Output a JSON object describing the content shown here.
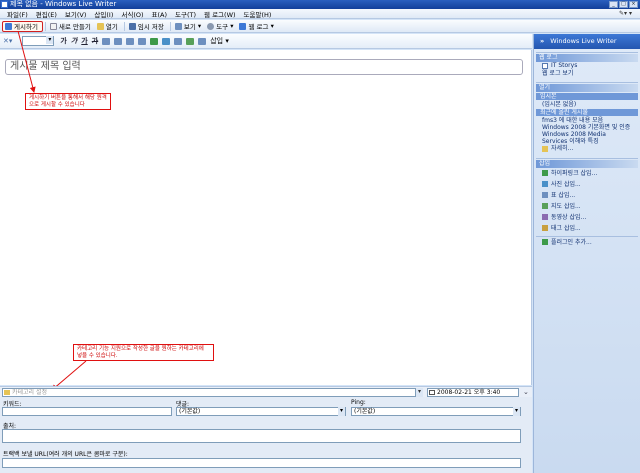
{
  "window": {
    "title": "제목 없음 - Windows Live Writer"
  },
  "menu": [
    "파일(F)",
    "편집(E)",
    "보기(V)",
    "삽입(I)",
    "서식(O)",
    "표(A)",
    "도구(T)",
    "웹 로그(W)",
    "도움말(H)"
  ],
  "toolbar": {
    "publish": "게시하기",
    "new": "새로 만들기",
    "open": "열기",
    "save_draft": "임시 저장",
    "view": "보기",
    "tools": "도구",
    "weblog": "웹 로그"
  },
  "format_toolbar": {
    "bold": "가",
    "italic": "가",
    "underline": "가",
    "strike": "가",
    "insert": "삽입"
  },
  "editor": {
    "title_placeholder": "게시물 제목 입력",
    "callout_top": "게시하기 버튼을 통해서 해당 원격으로 게시할 수 있습니다",
    "callout_bottom": "카테고리 기능 지원으로 작성한 글을 원하는 카테고리에 넣을 수 있습니다."
  },
  "category": {
    "placeholder": "카테고리 설정",
    "date": "2008-02-21 오후  3:40"
  },
  "properties": {
    "keywords_label": "키워드:",
    "comments_label": "댓글:",
    "comments_value": "(기본값)",
    "ping_label": "Ping:",
    "ping_value": "(기본값)",
    "source_label": "출처:",
    "trackback_label": "트랙백 보낼 URL(여러 개의 URL은 콤마로 구분):"
  },
  "sidebar": {
    "header": "Windows Live Writer",
    "blog_section": "웹 로그",
    "blog_name": "IT Storys",
    "view_blog": "웹 로그 보기",
    "open_section": "열기",
    "drafts_label": "임시본",
    "drafts_item": "(임시본 없음)",
    "recent_label": "최근에 올린 게시물",
    "recent_posts": [
      "fms3 에 대한 내용 모음",
      "Windows 2008 기본화면 및 인증",
      "Windows 2008 Media Services 이해와 특징"
    ],
    "more": "자세히...",
    "insert_section": "삽입",
    "insert_items": [
      "하이퍼링크 삽입...",
      "사진 삽입...",
      "표 삽입...",
      "지도 삽입...",
      "동영상 삽입...",
      "태그 삽입..."
    ],
    "add_plugin": "플러그인 추가..."
  },
  "colors": {
    "accent": "#2456b0",
    "callout_border": "#e01010"
  }
}
